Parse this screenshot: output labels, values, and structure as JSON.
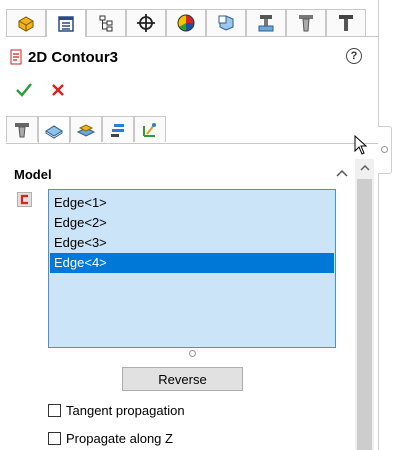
{
  "manager_tabs": [
    {
      "icon": "feature-manager-icon"
    },
    {
      "icon": "property-manager-icon"
    },
    {
      "icon": "configuration-manager-icon"
    },
    {
      "icon": "dimxpert-manager-icon"
    },
    {
      "icon": "display-manager-icon"
    },
    {
      "icon": "cam-feature-tree-icon"
    },
    {
      "icon": "cam-operation-tree-icon"
    },
    {
      "icon": "cam-tool-tree-icon"
    },
    {
      "icon": "cam-tool-holder-icon"
    }
  ],
  "property_manager": {
    "title": "2D Contour3",
    "help_icon": "help-icon",
    "ok_icon": "checkmark-icon",
    "cancel_icon": "close-icon"
  },
  "sub_tabs": [
    {
      "icon": "tool-tab-icon"
    },
    {
      "icon": "feature-tab-icon"
    },
    {
      "icon": "setup-tab-icon"
    },
    {
      "icon": "parameters-tab-icon"
    },
    {
      "icon": "links-tab-icon"
    }
  ],
  "model_group": {
    "title": "Model",
    "selection_icon": "edge-selection-icon",
    "items": [
      "Edge<1>",
      "Edge<2>",
      "Edge<3>",
      "Edge<4>"
    ],
    "selected_index": 3,
    "reverse_label": "Reverse",
    "tangent_label": "Tangent propagation",
    "tangent_checked": false,
    "propagate_label": "Propagate along Z",
    "propagate_checked": false
  },
  "colors": {
    "selection_bg": "#cce4f7",
    "selected_item": "#0078d7",
    "ok_green": "#2e9e3a",
    "cancel_red": "#d9231c"
  }
}
